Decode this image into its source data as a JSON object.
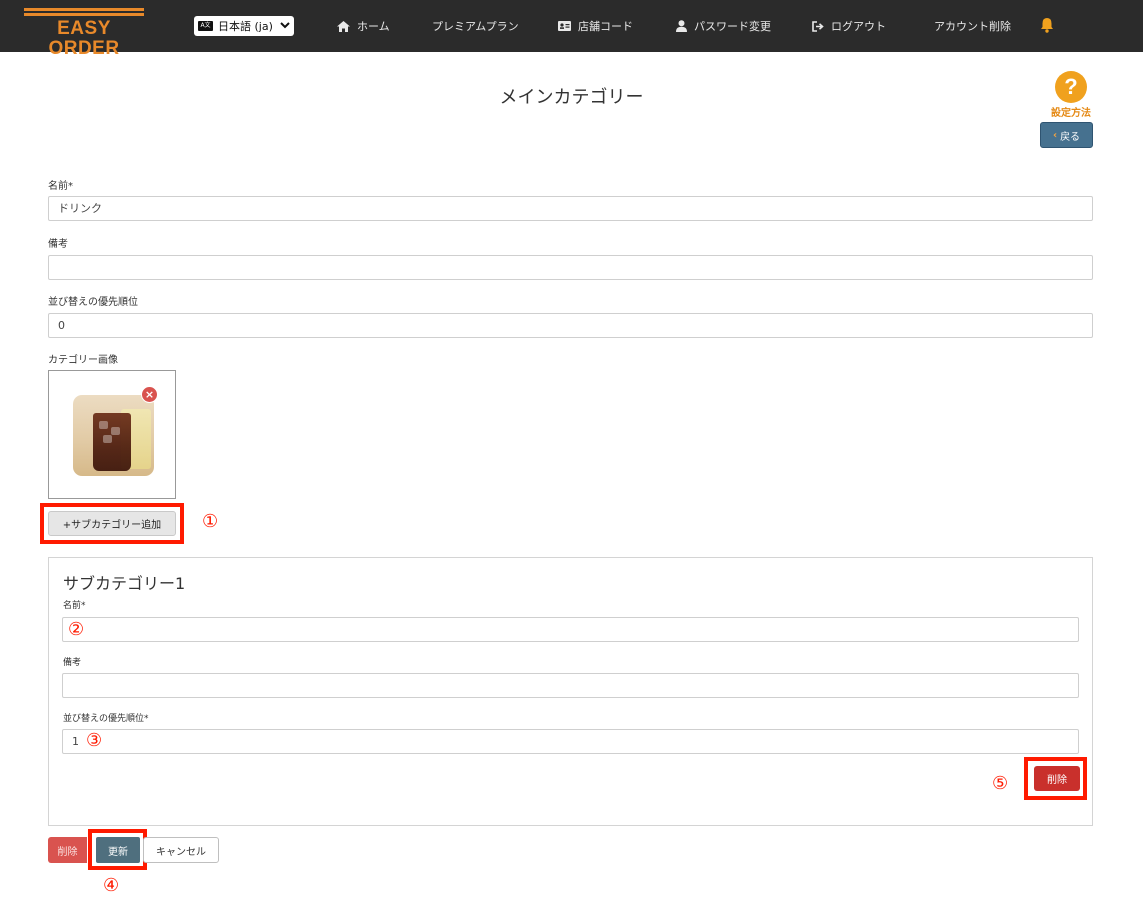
{
  "navbar": {
    "logo_text": "EASY ORDER",
    "language": "日本語 (ja)",
    "items": [
      {
        "label": "ホーム",
        "icon": "home-icon"
      },
      {
        "label": "プレミアムプラン",
        "icon": ""
      },
      {
        "label": "店舗コード",
        "icon": "id-card-icon"
      },
      {
        "label": "パスワード変更",
        "icon": "user-icon"
      },
      {
        "label": "ログアウト",
        "icon": "logout-icon"
      },
      {
        "label": "アカウント削除",
        "icon": ""
      }
    ],
    "notification_icon": "bell-icon"
  },
  "header": {
    "title": "メインカテゴリー",
    "help_label": "設定方法",
    "back_label": "戻る"
  },
  "main_form": {
    "name_label": "名前*",
    "name_value": "ドリンク",
    "note_label": "備考",
    "note_value": "",
    "priority_label": "並び替えの優先順位",
    "priority_value": "0",
    "image_label": "カテゴリー画像",
    "add_sub_label": "+サブカテゴリー追加"
  },
  "sub_category": {
    "title": "サブカテゴリー1",
    "name_label": "名前*",
    "name_value": "",
    "note_label": "備考",
    "note_value": "",
    "priority_label": "並び替えの優先順位*",
    "priority_value": "1",
    "delete_label": "削除"
  },
  "actions": {
    "delete_label": "削除",
    "update_label": "更新",
    "cancel_label": "キャンセル"
  },
  "annotations": [
    "①",
    "②",
    "③",
    "④",
    "⑤"
  ],
  "colors": {
    "navbar_bg": "#2b2b2b",
    "brand_orange": "#e8892a",
    "annotation_red": "#ff1a00",
    "update_button": "#4f6f7e",
    "danger": "#d9534f"
  }
}
